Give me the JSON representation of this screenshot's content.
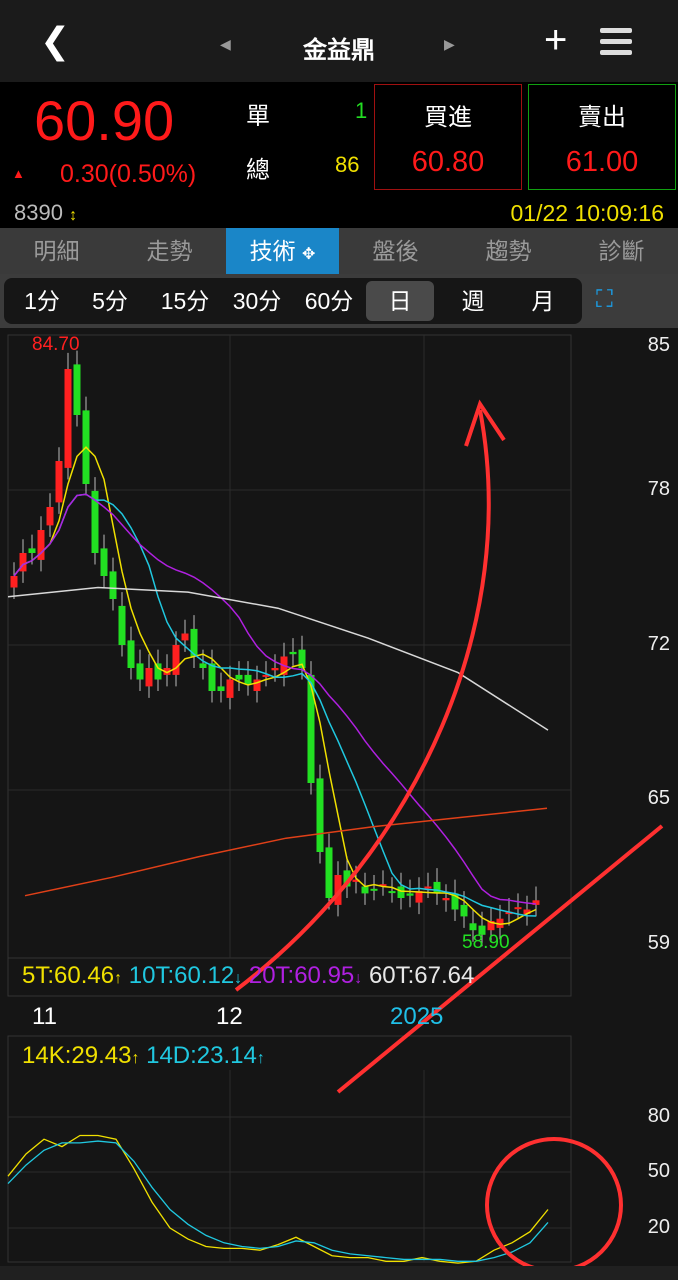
{
  "header": {
    "title": "金益鼎"
  },
  "quote": {
    "price": "60.90",
    "change": "0.30",
    "change_pct": "(0.50%)",
    "single_label": "單",
    "single_value": "1",
    "total_label": "總",
    "total_value": "86",
    "code": "8390",
    "datetime": "01/22 10:09:16",
    "buy_label": "買進",
    "buy_price": "60.80",
    "sell_label": "賣出",
    "sell_price": "61.00"
  },
  "tabs": [
    {
      "label": "明細"
    },
    {
      "label": "走勢"
    },
    {
      "label": "技術"
    },
    {
      "label": "盤後"
    },
    {
      "label": "趨勢"
    },
    {
      "label": "診斷"
    }
  ],
  "periods": [
    {
      "label": "1分"
    },
    {
      "label": "5分"
    },
    {
      "label": "15分"
    },
    {
      "label": "30分"
    },
    {
      "label": "60分"
    },
    {
      "label": "日"
    },
    {
      "label": "週"
    },
    {
      "label": "月"
    }
  ],
  "colors": {
    "up": "#ff2020",
    "down": "#22e022",
    "ma5": "#f0e000",
    "ma10": "#20c8e0",
    "ma20": "#b020e0",
    "ma60": "#d8d8d8",
    "long": "#e04018"
  },
  "chart_data": {
    "type": "candlestick",
    "y_ticks": [
      "85",
      "78",
      "72",
      "65",
      "59"
    ],
    "y_range": [
      59,
      85
    ],
    "x_labels": [
      "11",
      "12",
      "2025"
    ],
    "max_label": "84.70",
    "min_label": "58.90",
    "closes": [
      75,
      76,
      76,
      77,
      78,
      80,
      84,
      82,
      79,
      76,
      75,
      74,
      72,
      71,
      70.5,
      71,
      70.5,
      71,
      72,
      72.5,
      71.5,
      71,
      70,
      70,
      70.5,
      70.5,
      70.3,
      70.5,
      70.7,
      71,
      71.5,
      71.6,
      71,
      66,
      63,
      61,
      62,
      61.5,
      61.8,
      61.2,
      61.4,
      61.6,
      61.3,
      61,
      61.1,
      61.3,
      61.5,
      61.2,
      61,
      60.5,
      60.2,
      59.6,
      59.4,
      60,
      60.1,
      60.4,
      60.6,
      60.5,
      60.9
    ],
    "ma60": [
      74.1,
      74.5,
      74.3,
      73.6,
      72.3,
      70.8,
      68.3
    ],
    "ma_long": [
      61.1,
      61.9,
      62.8,
      63.6,
      64.1,
      64.5,
      64.9
    ],
    "legend": [
      {
        "text": "5T:60.46",
        "arrow": "↑"
      },
      {
        "text": "10T:60.12",
        "arrow": "↓"
      },
      {
        "text": "20T:60.95",
        "arrow": "↓"
      },
      {
        "text": "60T:67.64",
        "arrow": ""
      }
    ],
    "kd": {
      "legend": [
        {
          "text": "14K:29.43",
          "arrow": "↑"
        },
        {
          "text": "14D:23.14",
          "arrow": "↑"
        }
      ],
      "y_ticks": [
        "80",
        "50",
        "20"
      ],
      "k": [
        48,
        60,
        68,
        64,
        70,
        70,
        68,
        52,
        34,
        20,
        14,
        10,
        9,
        9,
        8,
        11,
        15,
        10,
        5,
        4,
        4,
        2,
        2,
        4,
        2,
        1,
        2,
        8,
        12,
        18,
        30
      ],
      "d": [
        44,
        54,
        62,
        66,
        66,
        67,
        66,
        56,
        42,
        30,
        22,
        16,
        12,
        10,
        9,
        10,
        13,
        12,
        8,
        6,
        5,
        4,
        3,
        3,
        3,
        2,
        2,
        4,
        7,
        12,
        23
      ]
    }
  }
}
